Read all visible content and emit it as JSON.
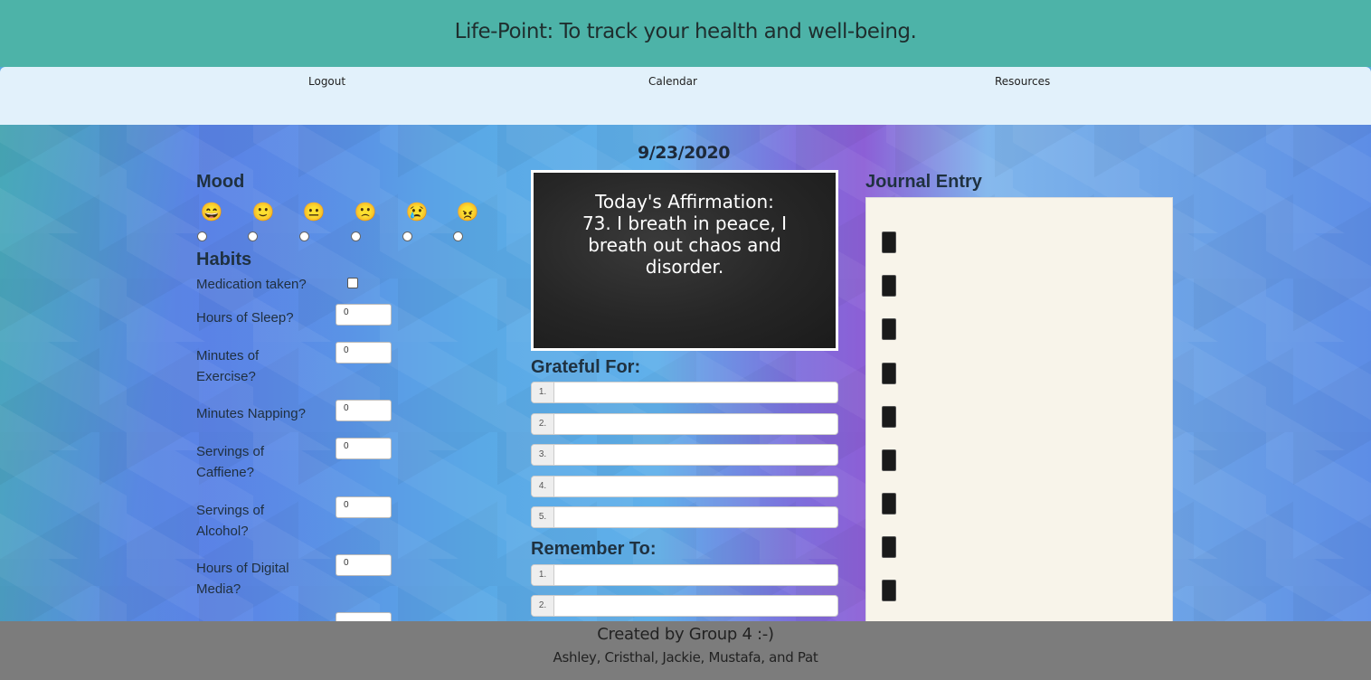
{
  "header": {
    "title": "Life-Point: To track your health and well-being."
  },
  "nav": {
    "items": [
      "Logout",
      "Calendar",
      "Resources"
    ]
  },
  "date": "9/23/2020",
  "mood": {
    "title": "Mood",
    "emojis": [
      "😄",
      "🙂",
      "😐",
      "🙁",
      "😢",
      "😠"
    ]
  },
  "habits": {
    "title": "Habits",
    "medication_label": "Medication taken?",
    "fields": [
      {
        "label": "Hours of Sleep?",
        "value": "0"
      },
      {
        "label": "Minutes of Exercise?",
        "value": "0"
      },
      {
        "label": "Minutes Napping?",
        "value": "0"
      },
      {
        "label": "Servings of Caffiene?",
        "value": "0"
      },
      {
        "label": "Servings of Alcohol?",
        "value": "0"
      },
      {
        "label": "Hours of Digital Media?",
        "value": "0"
      }
    ]
  },
  "affirmation": {
    "heading": "Today's Affirmation:",
    "text": "73. I breath in peace, I breath out chaos and disorder."
  },
  "grateful": {
    "title": "Grateful For:",
    "numbers": [
      "1.",
      "2.",
      "3.",
      "4.",
      "5."
    ]
  },
  "remember": {
    "title": "Remember To:",
    "numbers": [
      "1.",
      "2."
    ]
  },
  "journal": {
    "title": "Journal Entry"
  },
  "footer": {
    "line1": "Created by Group 4 :-)",
    "line2": "Ashley, Cristhal, Jackie, Mustafa, and Pat"
  }
}
